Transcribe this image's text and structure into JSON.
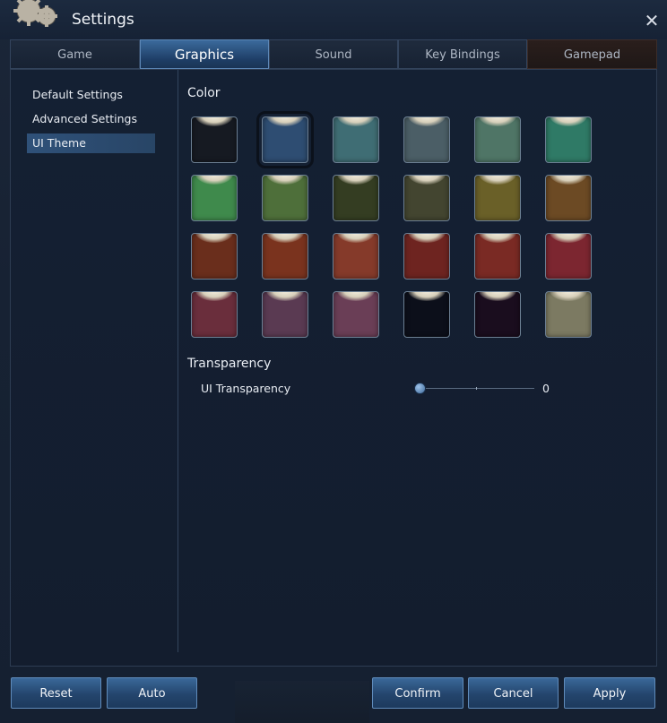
{
  "window": {
    "title": "Settings",
    "close_icon": "close-icon"
  },
  "tabs": [
    {
      "label": "Game",
      "active": false
    },
    {
      "label": "Graphics",
      "active": true
    },
    {
      "label": "Sound",
      "active": false
    },
    {
      "label": "Key Bindings",
      "active": false
    },
    {
      "label": "Gamepad",
      "active": false
    }
  ],
  "sidebar": {
    "items": [
      {
        "label": "Default Settings",
        "active": false
      },
      {
        "label": "Advanced Settings",
        "active": false
      },
      {
        "label": "UI Theme",
        "active": true
      }
    ]
  },
  "color_section": {
    "label": "Color",
    "selected_index": 1,
    "swatches": [
      "#161a22",
      "#2e4d72",
      "#3f6d74",
      "#4b5e66",
      "#4f7566",
      "#2f7a66",
      "#3f8a4c",
      "#4e6f3a",
      "#343d22",
      "#434530",
      "#6a6028",
      "#6c4a24",
      "#6a2e1c",
      "#7a331e",
      "#853a2a",
      "#6e2420",
      "#7a2a24",
      "#7c2630",
      "#6a2e3c",
      "#5a3a52",
      "#6a3e56",
      "#0c0f1a",
      "#1a0d1e",
      "#7c7a62"
    ]
  },
  "transparency": {
    "label": "Transparency",
    "ui_transparency_label": "UI Transparency",
    "value": "0"
  },
  "buttons": {
    "reset": "Reset",
    "auto": "Auto",
    "confirm": "Confirm",
    "cancel": "Cancel",
    "apply": "Apply"
  },
  "colors": {
    "accent": "#3a6899",
    "panel": "#142033"
  }
}
